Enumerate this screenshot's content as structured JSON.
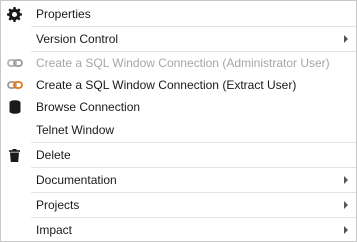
{
  "menu": {
    "items": [
      {
        "label": "Properties",
        "icon": "gear-icon"
      },
      {
        "label": "Version Control",
        "submenu": true
      },
      {
        "label": "Create a SQL Window Connection (Administrator User)",
        "icon": "link-icon",
        "disabled": true
      },
      {
        "label": "Create a SQL Window Connection (Extract User)",
        "icon": "link-icon"
      },
      {
        "label": "Browse Connection",
        "icon": "database-icon"
      },
      {
        "label": "Telnet Window"
      },
      {
        "label": "Delete",
        "icon": "trash-icon"
      },
      {
        "label": "Documentation",
        "submenu": true
      },
      {
        "label": "Projects",
        "submenu": true
      },
      {
        "label": "Impact",
        "submenu": true
      }
    ]
  },
  "colors": {
    "border": "#c8c8c8",
    "separator": "#e3e3e3",
    "disabled_text": "#a6a6a6",
    "link_orange": "#e8730c",
    "link_gray": "#9a9a9a"
  }
}
